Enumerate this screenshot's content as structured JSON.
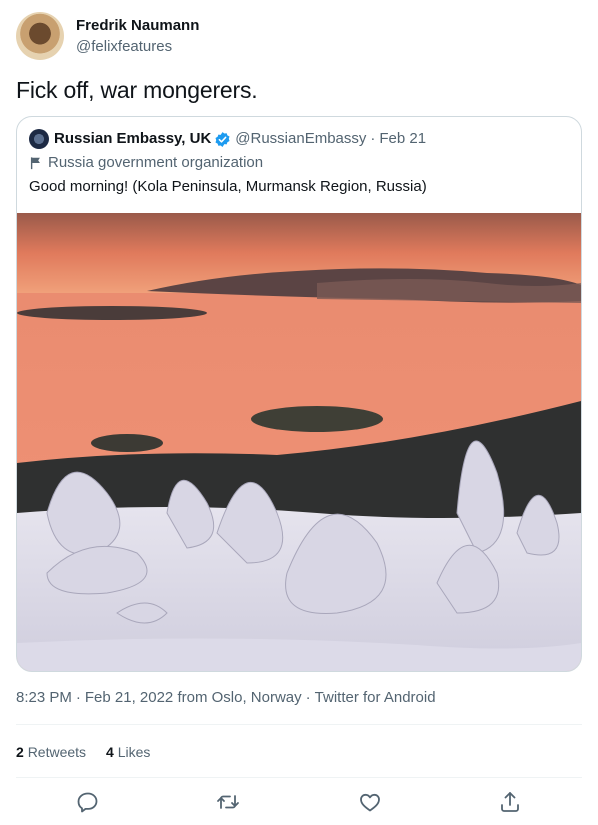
{
  "author": {
    "name": "Fredrik Naumann",
    "handle": "@felixfeatures",
    "avatar_icon": "profile-photo"
  },
  "tweet": {
    "text": "Fick off, war mongerers."
  },
  "quoted": {
    "name": "Russian Embassy, UK",
    "handle": "@RussianEmbassy",
    "separator": "·",
    "date": "Feb 21",
    "verified": true,
    "label_icon": "flag-icon",
    "label": "Russia government organization",
    "text": "Good morning! (Kola Peninsula, Murmansk Region, Russia)",
    "media": "Sunset over water with snow-covered trees"
  },
  "meta": {
    "time": "8:23 PM",
    "dot1": "·",
    "date": "Feb 21, 2022",
    "from": "from Oslo, Norway",
    "dot2": "·",
    "client": "Twitter for Android"
  },
  "stats": {
    "retweets_count": "2",
    "retweets_label": "Retweets",
    "likes_count": "4",
    "likes_label": "Likes"
  },
  "actions": [
    {
      "icon": "reply-icon"
    },
    {
      "icon": "retweet-icon"
    },
    {
      "icon": "like-icon"
    },
    {
      "icon": "share-icon"
    }
  ],
  "colors": {
    "text": "#0f1419",
    "secondary": "#536471",
    "border": "#cfd9de",
    "verified": "#1d9bf0"
  }
}
